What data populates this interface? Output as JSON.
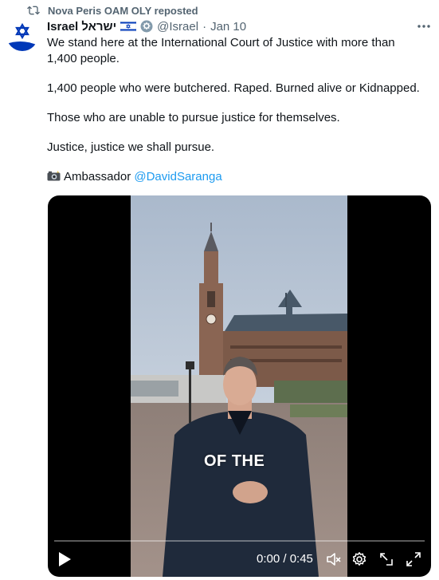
{
  "repost": {
    "text": "Nova Peris OAM OLY reposted",
    "icon": "repost-icon"
  },
  "author": {
    "display_name": "Israel ישראל",
    "handle": "@Israel",
    "separator": "·",
    "date": "Jan 10",
    "flag_icon": "israel-flag-icon",
    "badge_icon": "government-badge-icon",
    "avatar_icon": "star-of-david-icon"
  },
  "post": {
    "paragraphs": [
      "We stand here at the International Court of Justice with more than 1,400 people.",
      "1,400 people who were butchered. Raped. Burned alive or Kidnapped.",
      "Those who are unable to pursue justice for themselves.",
      "Justice, justice we shall pursue."
    ],
    "credit_prefix": "Ambassador ",
    "mention": "@DavidSaranga",
    "camera_icon": "camera-flash-icon"
  },
  "video": {
    "caption": "OF THE",
    "time": "0:00 / 0:45",
    "progress": 0.0,
    "controls": [
      "play-icon",
      "volume-mute-icon",
      "settings-gear-icon",
      "pop-out-icon",
      "fullscreen-icon"
    ]
  },
  "colors": {
    "accent": "#1d9bf0",
    "secondary_text": "#536471",
    "primary_text": "#0f1419",
    "israel_blue": "#0038b8"
  }
}
